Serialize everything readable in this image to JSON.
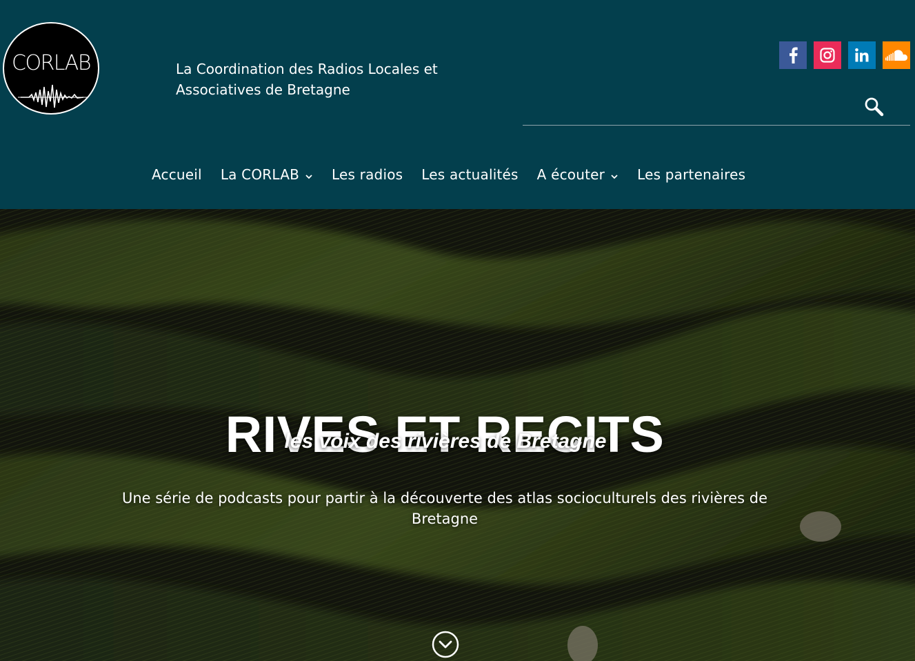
{
  "logo": {
    "text": "CORLAB"
  },
  "header": {
    "tagline": "La Coordination des Radios Locales et Associatives de Bretagne"
  },
  "socials": [
    {
      "name": "facebook",
      "icon": "facebook-icon",
      "color": "#3b5998"
    },
    {
      "name": "instagram",
      "icon": "instagram-icon",
      "color": "#ea2c59"
    },
    {
      "name": "linkedin",
      "icon": "linkedin-icon",
      "color": "#007bb6"
    },
    {
      "name": "soundcloud",
      "icon": "soundcloud-icon",
      "color": "#ff8800"
    }
  ],
  "search": {
    "value": "",
    "placeholder": ""
  },
  "nav": {
    "items": [
      {
        "label": "Accueil",
        "has_dropdown": false
      },
      {
        "label": "La CORLAB",
        "has_dropdown": true
      },
      {
        "label": "Les radios",
        "has_dropdown": false
      },
      {
        "label": "Les actualités",
        "has_dropdown": false
      },
      {
        "label": "A écouter",
        "has_dropdown": true
      },
      {
        "label": "Les partenaires",
        "has_dropdown": false
      }
    ]
  },
  "hero": {
    "title": "RIVES ET RECITS",
    "subtitle": "les voix des rivières de Bretagne",
    "description": "Une série de podcasts pour partir à la découverte des atlas socioculturels des rivières de Bretagne"
  },
  "colors": {
    "header_bg": "#033f4d",
    "text": "#ffffff"
  }
}
